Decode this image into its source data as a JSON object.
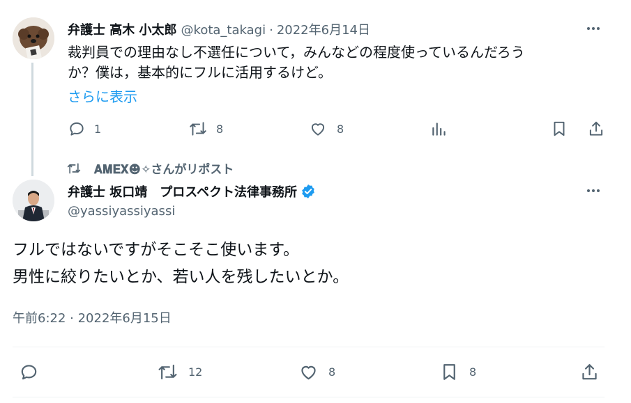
{
  "tweet1": {
    "author_name": "弁護士 高木 小太郎",
    "handle": "@kota_takagi",
    "sep": "·",
    "date": "2022年6月14日",
    "text_line1": "裁判員での理由なし不選任について，みんなどの程度使っているんだろう",
    "text_line2": "か？僕は，基本的にフルに活用するけど。",
    "show_more": "さらに表示",
    "replies": "1",
    "reposts": "8",
    "likes": "8"
  },
  "repost_banner": {
    "text": "𝐀𝐌𝐄𝐗☻✧さんがリポスト"
  },
  "tweet2": {
    "author_name": "弁護士 坂口靖　プロスペクト法律事務所",
    "handle": "@yassiyassiyassi",
    "text_line1": "フルではないですがそこそこ使います。",
    "text_line2": "男性に絞りたいとか、若い人を残したいとか。",
    "timestamp": "午前6:22 · 2022年6月15日",
    "replies": "",
    "reposts": "12",
    "likes": "8",
    "bookmarks": "8"
  },
  "colors": {
    "text": "#0f1419",
    "secondary": "#536471",
    "link": "#1d9bf0",
    "verified": "#1d9bf0",
    "thread_line": "#cfd9de",
    "divider": "#eff3f4"
  },
  "icons": [
    "reply-icon",
    "repost-icon",
    "like-icon",
    "views-icon",
    "bookmark-icon",
    "share-icon",
    "verified-badge-icon",
    "more-icon"
  ]
}
